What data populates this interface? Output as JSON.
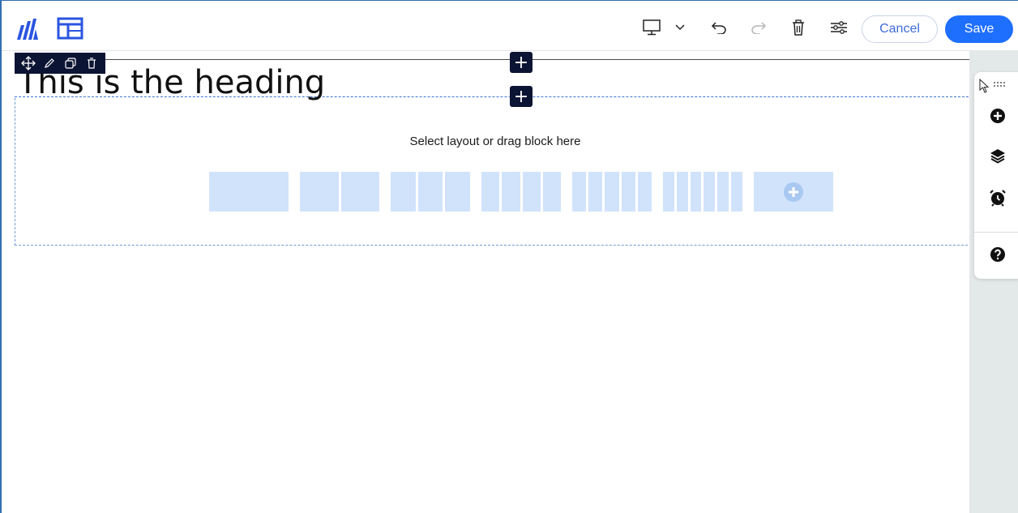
{
  "toolbar": {
    "cancel_label": "Cancel",
    "save_label": "Save",
    "icons": [
      "logo-icon",
      "layout-icon",
      "desktop-icon",
      "chevron-down-icon",
      "undo-icon",
      "redo-icon",
      "trash-icon",
      "settings-sliders-icon"
    ]
  },
  "block_toolbar": {
    "icons": [
      "move-icon",
      "edit-icon",
      "duplicate-icon",
      "delete-icon"
    ]
  },
  "canvas": {
    "heading": "This is the heading",
    "drop_text": "Select layout or drag block here",
    "layout_options": [
      1,
      2,
      3,
      4,
      5,
      6
    ]
  },
  "side_panel": {
    "icons": [
      "cursor-icon",
      "drag-handle-icon",
      "add-icon",
      "layers-icon",
      "alarm-icon",
      "help-icon"
    ]
  },
  "colors": {
    "accent": "#1f6fff",
    "dark": "#0b1433",
    "layout_fill": "#d1e3fb"
  }
}
